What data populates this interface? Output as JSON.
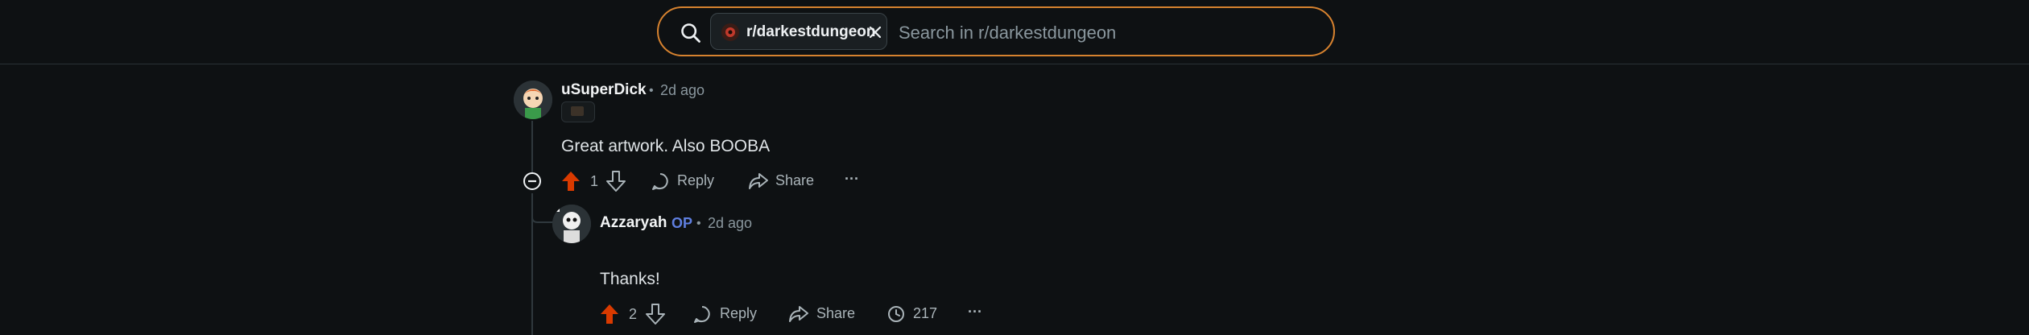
{
  "search": {
    "community_chip": "r/darkestdungeon",
    "placeholder": "Search in r/darkestdungeon"
  },
  "comments": [
    {
      "author": "uSuperDick",
      "separator": "•",
      "time": "2d ago",
      "body": "Great artwork. Also BOOBA",
      "votes": "1",
      "reply_label": "Reply",
      "share_label": "Share",
      "more_label": "···"
    },
    {
      "author": "Azzaryah",
      "op_badge": "OP",
      "separator": "•",
      "time": "2d ago",
      "body": "Thanks!",
      "votes": "2",
      "reply_label": "Reply",
      "share_label": "Share",
      "views": "217",
      "more_label": "···"
    }
  ],
  "colors": {
    "background": "#0e1113",
    "search_border": "#d6822f",
    "upvote_active": "#d93a00",
    "op_badge": "#5f7fe0"
  },
  "icons": [
    "search-icon",
    "subreddit-icon",
    "close-icon",
    "upvote-icon",
    "downvote-icon",
    "comment-icon",
    "share-icon",
    "views-icon",
    "more-icon",
    "collapse-icon"
  ]
}
